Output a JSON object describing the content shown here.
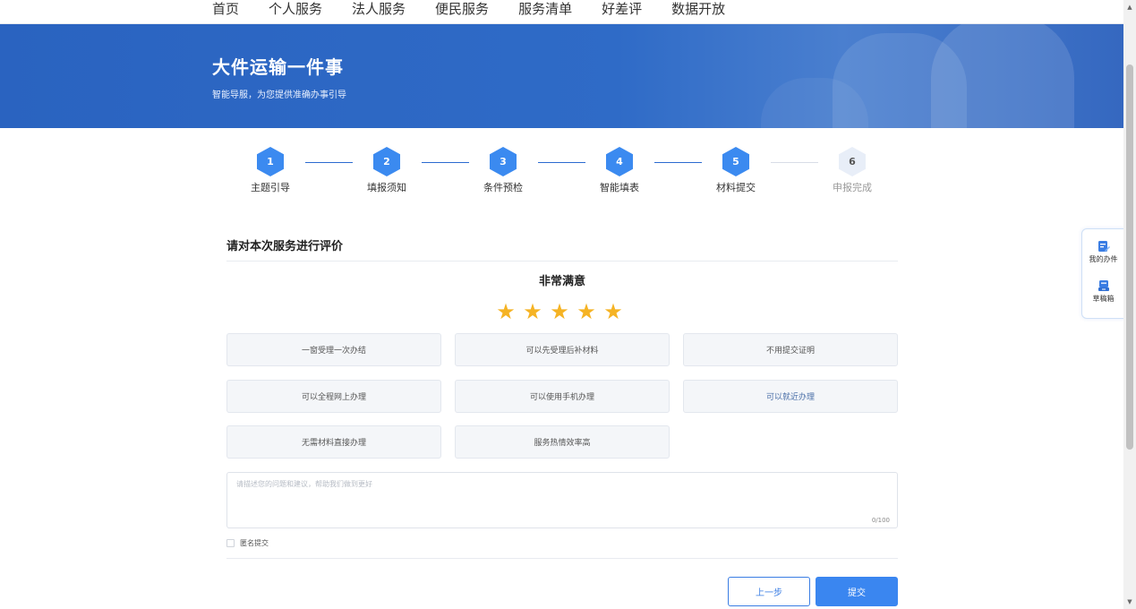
{
  "nav": {
    "items": [
      {
        "label": "首页"
      },
      {
        "label": "个人服务"
      },
      {
        "label": "法人服务"
      },
      {
        "label": "便民服务"
      },
      {
        "label": "服务清单"
      },
      {
        "label": "好差评"
      },
      {
        "label": "数据开放"
      }
    ]
  },
  "banner": {
    "title": "大件运输一件事",
    "subtitle": "智能导服，为您提供准确办事引导"
  },
  "steps": [
    {
      "number": "1",
      "label": "主题引导",
      "status": "done"
    },
    {
      "number": "2",
      "label": "填报须知",
      "status": "done"
    },
    {
      "number": "3",
      "label": "条件预检",
      "status": "done"
    },
    {
      "number": "4",
      "label": "智能填表",
      "status": "done"
    },
    {
      "number": "5",
      "label": "材料提交",
      "status": "done"
    },
    {
      "number": "6",
      "label": "申报完成",
      "status": "pending"
    }
  ],
  "evaluation": {
    "section_title": "请对本次服务进行评价",
    "rating_text": "非常满意",
    "rating": 5,
    "max_rating": 5,
    "tags": [
      {
        "label": "一窗受理一次办结"
      },
      {
        "label": "可以先受理后补材料"
      },
      {
        "label": "不用提交证明"
      },
      {
        "label": "可以全程网上办理"
      },
      {
        "label": "可以使用手机办理"
      },
      {
        "label": "可以就近办理"
      },
      {
        "label": "无需材料直接办理"
      },
      {
        "label": "服务热情效率高"
      }
    ],
    "comment_placeholder": "请描述您的问题和建议，帮助我们做到更好",
    "comment_value": "",
    "comment_counter": "0/100",
    "anonymous_label": "匿名提交",
    "anonymous_checked": false
  },
  "buttons": {
    "prev_label": "上一步",
    "submit_label": "提交"
  },
  "side_panel": {
    "items": [
      {
        "label": "我的办件",
        "icon": "document-edit-icon"
      },
      {
        "label": "草稿箱",
        "icon": "draft-box-icon"
      }
    ]
  },
  "colors": {
    "primary": "#3a86f0",
    "banner": "#2a63c0",
    "star": "#f5b324",
    "step_active": "#3b8af0",
    "step_pending": "#e8eef8"
  }
}
